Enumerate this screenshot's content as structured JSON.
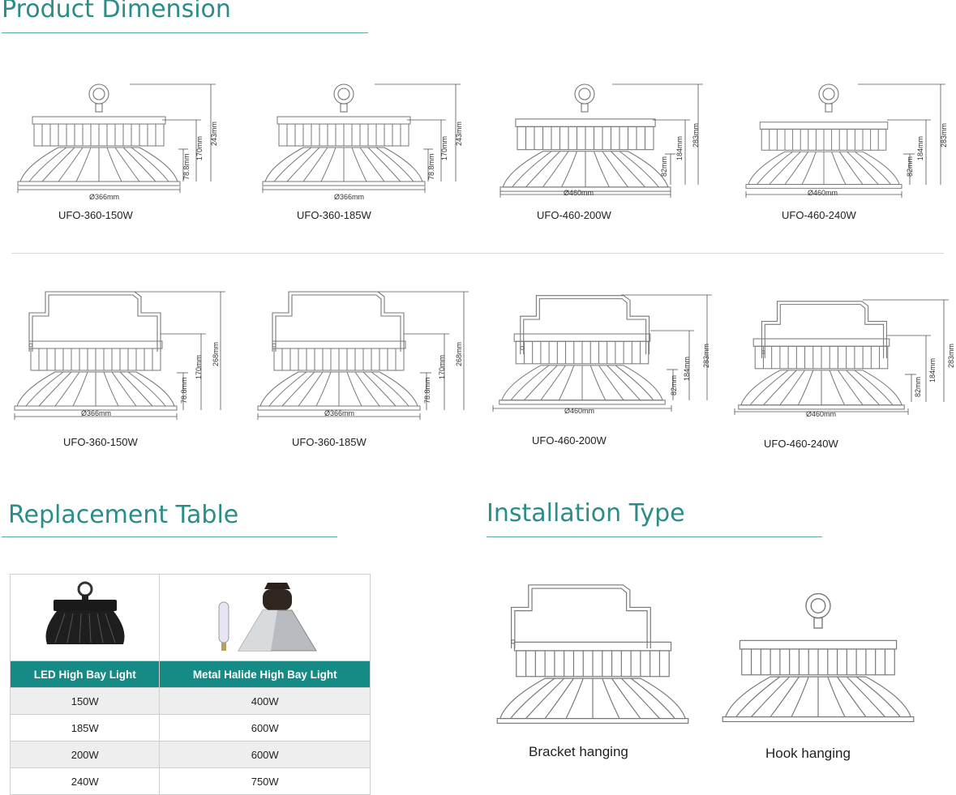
{
  "sections": {
    "product_dimension": "Product Dimension",
    "replacement_table": "Replacement Table",
    "installation_type": "Installation Type"
  },
  "hook_row": [
    {
      "model": "UFO-360-150W",
      "dia": "Ø366mm",
      "low": "78.8mm",
      "mid": "170mm",
      "top": "243mm"
    },
    {
      "model": "UFO-360-185W",
      "dia": "Ø366mm",
      "low": "78.8mm",
      "mid": "170mm",
      "top": "243mm"
    },
    {
      "model": "UFO-460-200W",
      "dia": "Ø460mm",
      "low": "82mm",
      "mid": "184mm",
      "top": "283mm"
    },
    {
      "model": "UFO-460-240W",
      "dia": "Ø460mm",
      "low": "82mm",
      "mid": "184mm",
      "top": "283mm"
    }
  ],
  "bracket_row": [
    {
      "model": "UFO-360-150W",
      "dia": "Ø366mm",
      "low": "78.8mm",
      "mid": "170mm",
      "top": "268mm"
    },
    {
      "model": "UFO-360-185W",
      "dia": "Ø366mm",
      "low": "78.8mm",
      "mid": "170mm",
      "top": "268mm"
    },
    {
      "model": "UFO-460-200W",
      "dia": "Ø460mm",
      "low": "82mm",
      "mid": "184mm",
      "top": "283mm"
    },
    {
      "model": "UFO-460-240W",
      "dia": "Ø460mm",
      "low": "82mm",
      "mid": "184mm",
      "top": "283mm"
    }
  ],
  "replacement": {
    "headers": [
      "LED High Bay Light",
      "Metal Halide High Bay Light"
    ],
    "rows": [
      [
        "150W",
        "400W"
      ],
      [
        "185W",
        "600W"
      ],
      [
        "200W",
        "600W"
      ],
      [
        "240W",
        "750W"
      ]
    ]
  },
  "installation": {
    "bracket_label": "Bracket hanging",
    "hook_label": "Hook hanging"
  },
  "colors": {
    "accent": "#2b8c88",
    "table_header": "#168a85",
    "line": "#777777"
  }
}
